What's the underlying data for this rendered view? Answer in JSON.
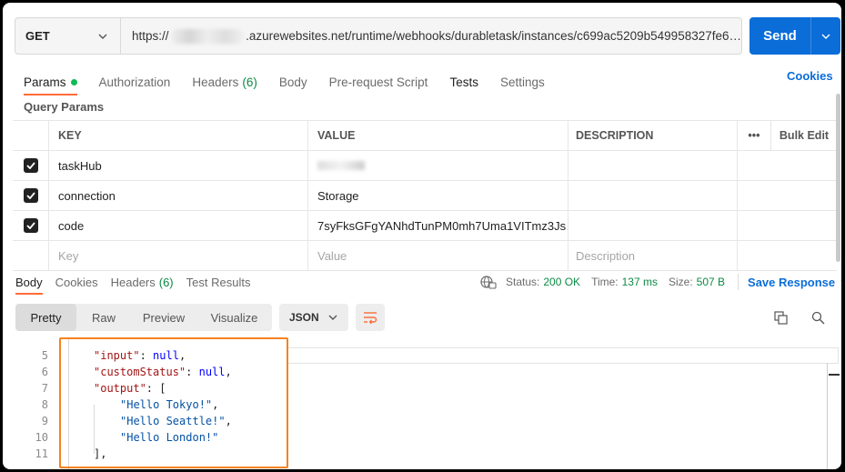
{
  "request": {
    "method": "GET",
    "url_prefix": "https://",
    "url_rest": ".azurewebsites.net/runtime/webhooks/durabletask/instances/c699ac5209b549958327fe6…",
    "send_label": "Send"
  },
  "request_tabs": {
    "params": "Params",
    "authorization": "Authorization",
    "headers": "Headers",
    "headers_count": "(6)",
    "body": "Body",
    "prerequest": "Pre-request Script",
    "tests": "Tests",
    "settings": "Settings",
    "cookies": "Cookies"
  },
  "query_params": {
    "title": "Query Params",
    "columns": {
      "key": "KEY",
      "value": "VALUE",
      "description": "DESCRIPTION",
      "more": "•••",
      "bulk_edit": "Bulk Edit"
    },
    "rows": [
      {
        "key": "taskHub",
        "value": "",
        "checked": true
      },
      {
        "key": "connection",
        "value": "Storage",
        "checked": true
      },
      {
        "key": "code",
        "value": "7syFksGFgYANhdTunPM0mh7Uma1VITmz3Js…",
        "checked": true
      }
    ],
    "placeholders": {
      "key": "Key",
      "value": "Value",
      "description": "Description"
    }
  },
  "response_tabs": {
    "body": "Body",
    "cookies": "Cookies",
    "headers": "Headers",
    "headers_count": "(6)",
    "test_results": "Test Results"
  },
  "response_meta": {
    "status_label": "Status:",
    "status_value": "200 OK",
    "time_label": "Time:",
    "time_value": "137 ms",
    "size_label": "Size:",
    "size_value": "507 B",
    "save_response": "Save Response"
  },
  "response_toolbar": {
    "pretty": "Pretty",
    "raw": "Raw",
    "preview": "Preview",
    "visualize": "Visualize",
    "format": "JSON"
  },
  "code_lines": [
    {
      "num": "5",
      "key": "\"input\"",
      "rest": ": ",
      "val": "null",
      "tail": ","
    },
    {
      "num": "6",
      "key": "\"customStatus\"",
      "rest": ": ",
      "val": "null",
      "tail": ","
    },
    {
      "num": "7",
      "key": "\"output\"",
      "rest": ": [",
      "val": "",
      "tail": ""
    },
    {
      "num": "8",
      "str": "\"Hello Tokyo!\"",
      "tail": ","
    },
    {
      "num": "9",
      "str": "\"Hello Seattle!\"",
      "tail": ","
    },
    {
      "num": "10",
      "str": "\"Hello London!\"",
      "tail": ""
    },
    {
      "num": "11",
      "punct": "],",
      "tail": ""
    }
  ]
}
